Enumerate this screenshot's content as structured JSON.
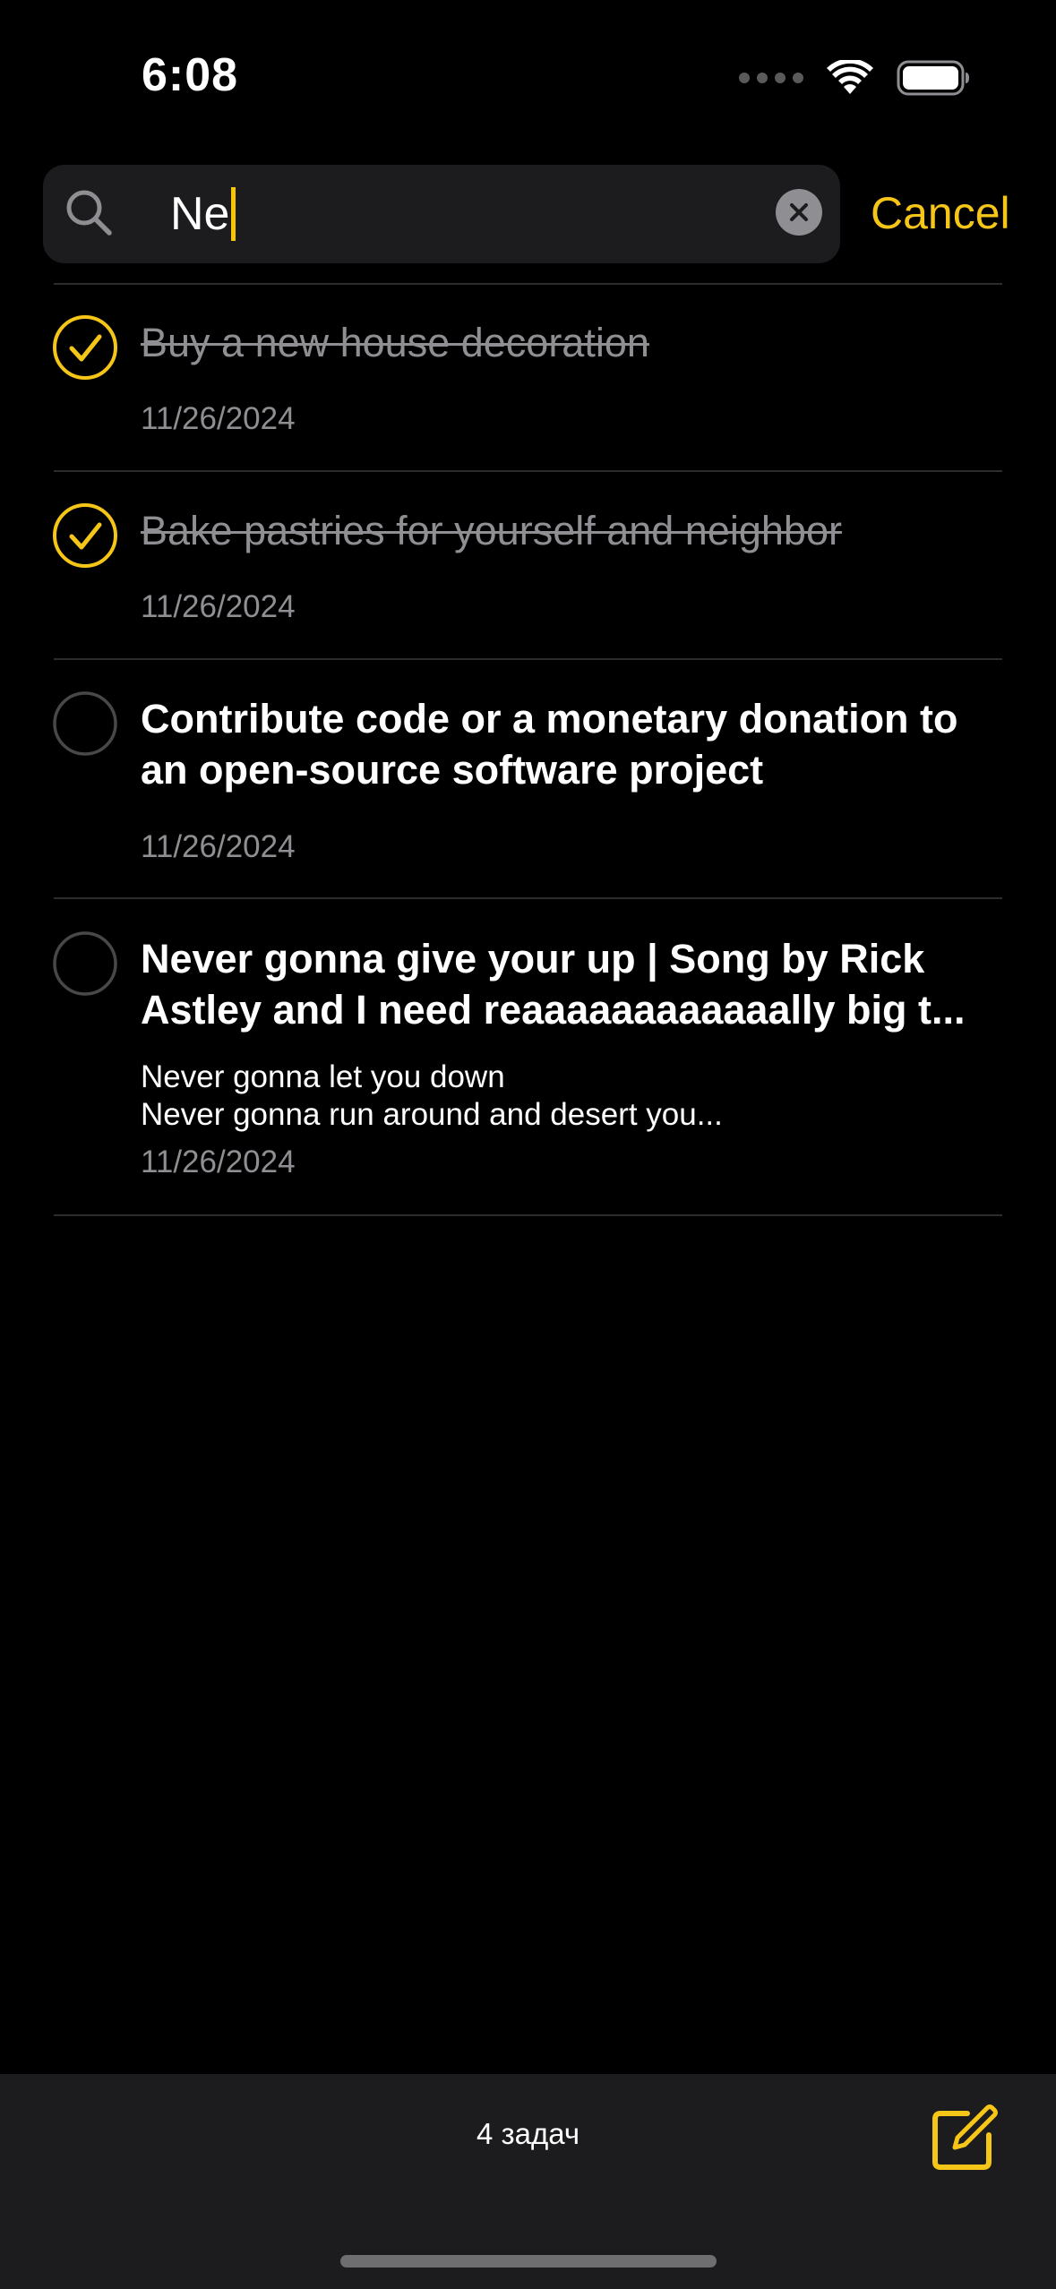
{
  "status_bar": {
    "time": "6:08"
  },
  "search": {
    "query": "Ne",
    "cancel_label": "Cancel"
  },
  "tasks": [
    {
      "title": "Buy a new house decoration",
      "description": "",
      "date": "11/26/2024",
      "completed": true
    },
    {
      "title": "Bake pastries for yourself and neighbor",
      "description": "",
      "date": "11/26/2024",
      "completed": true
    },
    {
      "title": "Contribute code or a monetary donation to an open-source software project",
      "description": "",
      "date": "11/26/2024",
      "completed": false
    },
    {
      "title": "Never gonna give your up | Song by Rick Astley and I need reaaaaaaaaaaaally big t...",
      "description": "Never gonna let you down\nNever gonna run around and desert you...",
      "date": "11/26/2024",
      "completed": false
    }
  ],
  "footer": {
    "count_label": "4 задач"
  },
  "colors": {
    "accent": "#F5C518",
    "background": "#000000",
    "secondary_text": "#8E8E93",
    "bar_background": "#1C1C1E"
  },
  "icons": [
    "search-icon",
    "clear-icon",
    "checkmark-circle-icon",
    "empty-circle-icon",
    "compose-icon",
    "wifi-icon",
    "battery-icon"
  ]
}
